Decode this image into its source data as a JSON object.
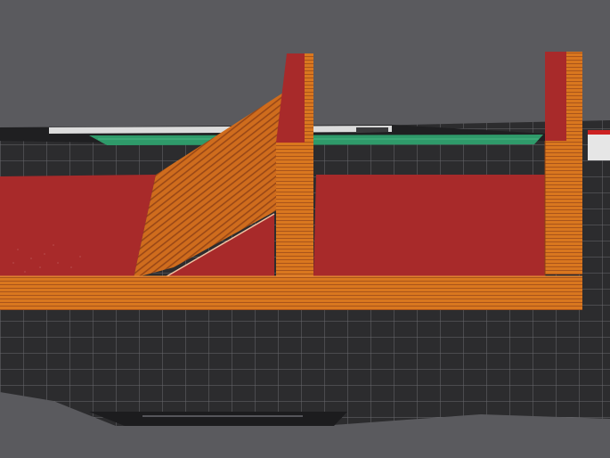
{
  "app": {
    "view": "3d-preview",
    "description_colors": {
      "background": "#5a5a5e",
      "bed_surface": "#2c2c2e",
      "bed_grid": "#6e6e72",
      "bed_edge": "#1a1a1c",
      "part_wall": "#d0701e",
      "part_wall_dark": "#a9541a",
      "part_top": "#a82a2a",
      "far_band_green": "#2f9a6a",
      "far_band_light": "#dcdcdc"
    }
  },
  "model": {
    "name": "",
    "layer_lines": true
  }
}
